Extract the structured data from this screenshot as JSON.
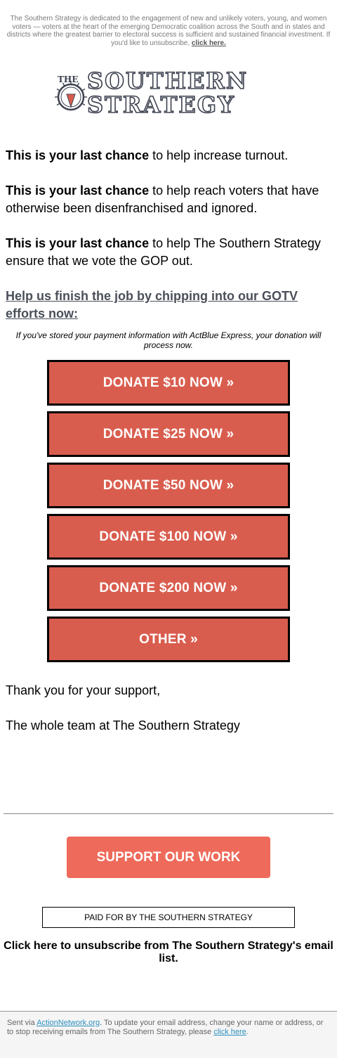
{
  "preheader": {
    "text": "The Southern Strategy is dedicated to the engagement of new and unlikely voters, young, and women voters — voters at the heart of the emerging Democratic coalition across the South and in states and districts where the greatest barrier to electoral success is sufficient and sustained financial investment. If you'd like to unsubscribe,",
    "link": "click here."
  },
  "logo": {
    "line1_small": "THE",
    "line1": "SOUTHERN",
    "line2": "STRATEGY"
  },
  "paragraphs": [
    {
      "bold": "This is your last chance",
      "rest": " to help increase turnout."
    },
    {
      "bold": "This is your last chance",
      "rest": " to help reach voters that have otherwise been disenfranchised and ignored."
    },
    {
      "bold": "This is your last chance",
      "rest": " to help The Southern Strategy ensure that we vote the GOP out."
    }
  ],
  "cta_link": "Help us finish the job by chipping into our GOTV efforts now:",
  "express_note": "If you've stored your payment information with ActBlue Express, your donation will process now.",
  "donate_buttons": [
    "DONATE $10 NOW »",
    "DONATE $25 NOW »",
    "DONATE $50 NOW »",
    "DONATE $100 NOW »",
    "DONATE $200 NOW »",
    "OTHER »"
  ],
  "signoff": {
    "thanks": "Thank you for your support,",
    "team": "The whole team at The Southern Strategy"
  },
  "support_button": "SUPPORT OUR WORK",
  "paid_for": "PAID FOR BY THE SOUTHERN STRATEGY",
  "unsubscribe": "Click here to unsubscribe from The Southern Strategy's email list.",
  "footer": {
    "sent_via": "Sent via ",
    "provider_link": "ActionNetwork.org",
    "middle": ". To update your email address, change your name or address, or to stop receiving emails from The Southern Strategy, please ",
    "click_here": "click here",
    "end": "."
  },
  "colors": {
    "donate_bg": "#d95d4e",
    "support_bg": "#ee6a5a",
    "cta_link": "#4a4f59",
    "logo_text": "#3d4250",
    "footer_link": "#2a8fbd"
  }
}
